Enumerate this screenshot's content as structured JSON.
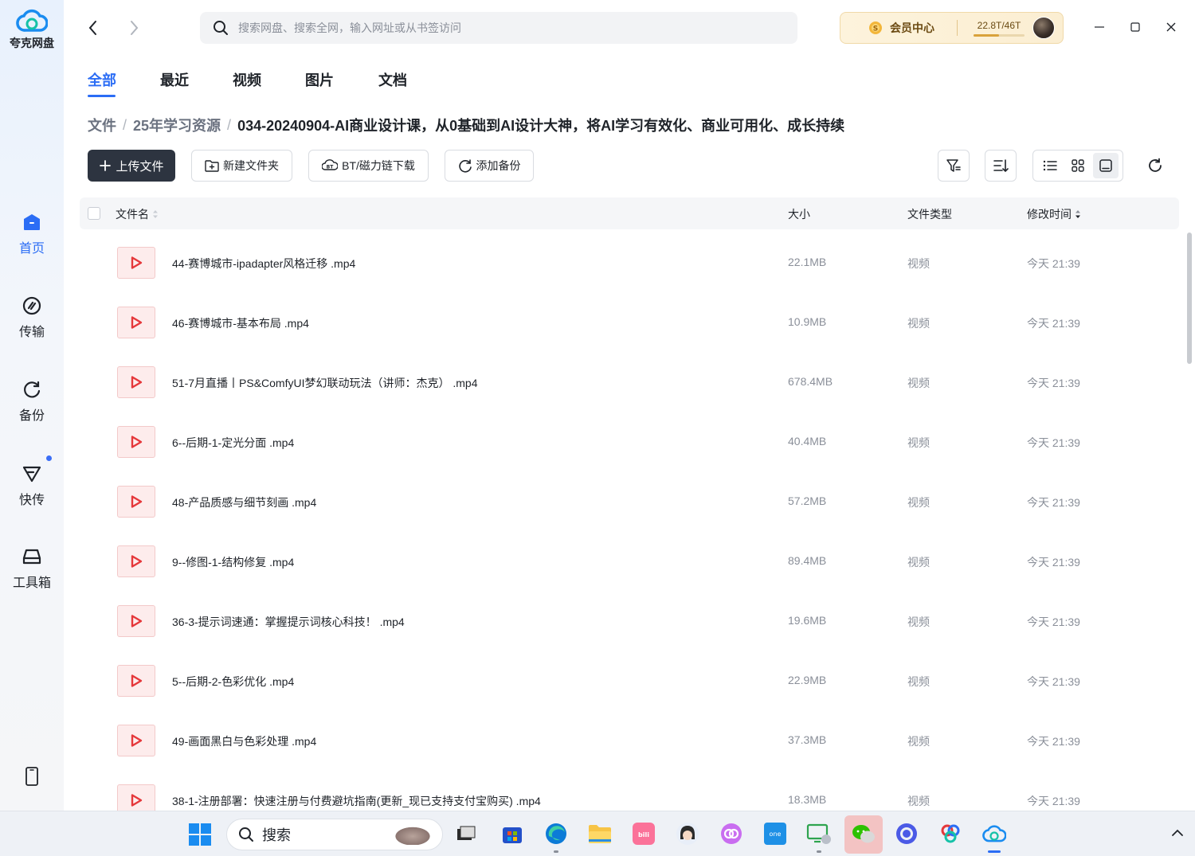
{
  "app": {
    "name": "夸克网盘"
  },
  "sidebar": {
    "items": [
      {
        "label": "首页",
        "icon": "home-icon",
        "active": true
      },
      {
        "label": "传输",
        "icon": "transfer-icon"
      },
      {
        "label": "备份",
        "icon": "backup-icon"
      },
      {
        "label": "快传",
        "icon": "send-icon",
        "has_dot": true
      },
      {
        "label": "工具箱",
        "icon": "toolbox-icon"
      }
    ],
    "bottom_icon": "phone-icon"
  },
  "topbar": {
    "search_placeholder": "搜索网盘、搜索全网，输入网址或从书签访问",
    "vip_label": "会员中心",
    "storage_text": "22.8T/46T",
    "storage_used_fraction": 0.5
  },
  "tabs": [
    "全部",
    "最近",
    "视频",
    "图片",
    "文档"
  ],
  "breadcrumb": {
    "items": [
      "文件",
      "25年学习资源"
    ],
    "current": "034-20240904-AI商业设计课，从0基础到AI设计大神，将AI学习有效化、商业可用化、成长持续"
  },
  "toolbar": {
    "upload": "上传文件",
    "new_folder": "新建文件夹",
    "bt_download": "BT/磁力链下载",
    "add_backup": "添加备份"
  },
  "table": {
    "headers": {
      "name": "文件名",
      "size": "大小",
      "type": "文件类型",
      "modified": "修改时间"
    },
    "rows": [
      {
        "name": "44-赛博城市-ipadapter风格迁移 .mp4",
        "size": "22.1MB",
        "type": "视频",
        "time": "今天 21:39"
      },
      {
        "name": "46-赛博城市-基本布局 .mp4",
        "size": "10.9MB",
        "type": "视频",
        "time": "今天 21:39"
      },
      {
        "name": "51-7月直播丨PS&ComfyUI梦幻联动玩法（讲师：杰克） .mp4",
        "size": "678.4MB",
        "type": "视频",
        "time": "今天 21:39"
      },
      {
        "name": "6--后期-1-定光分面 .mp4",
        "size": "40.4MB",
        "type": "视频",
        "time": "今天 21:39"
      },
      {
        "name": "48-产品质感与细节刻画 .mp4",
        "size": "57.2MB",
        "type": "视频",
        "time": "今天 21:39"
      },
      {
        "name": "9--修图-1-结构修复 .mp4",
        "size": "89.4MB",
        "type": "视频",
        "time": "今天 21:39"
      },
      {
        "name": "36-3-提示词速通：掌握提示词核心科技！ .mp4",
        "size": "19.6MB",
        "type": "视频",
        "time": "今天 21:39"
      },
      {
        "name": "5--后期-2-色彩优化 .mp4",
        "size": "22.9MB",
        "type": "视频",
        "time": "今天 21:39"
      },
      {
        "name": "49-画面黑白与色彩处理 .mp4",
        "size": "37.3MB",
        "type": "视频",
        "time": "今天 21:39"
      },
      {
        "name": "38-1-注册部署：快速注册与付费避坑指南(更新_现已支持支付宝购买) .mp4",
        "size": "18.3MB",
        "type": "视频",
        "time": "今天 21:39"
      }
    ]
  },
  "taskbar": {
    "search_label": "搜索",
    "apps": [
      "task-view",
      "store",
      "edge",
      "file-explorer",
      "bilibili",
      "avatar-app",
      "link-app",
      "onenote",
      "remote-app",
      "wechat",
      "browser-app",
      "photos-app",
      "quark-drive"
    ]
  },
  "colors": {
    "accent": "#2b6df5",
    "primary_button": "#2d3440",
    "video_icon": "#e5383b",
    "vip_bg": "#fbeed2"
  }
}
